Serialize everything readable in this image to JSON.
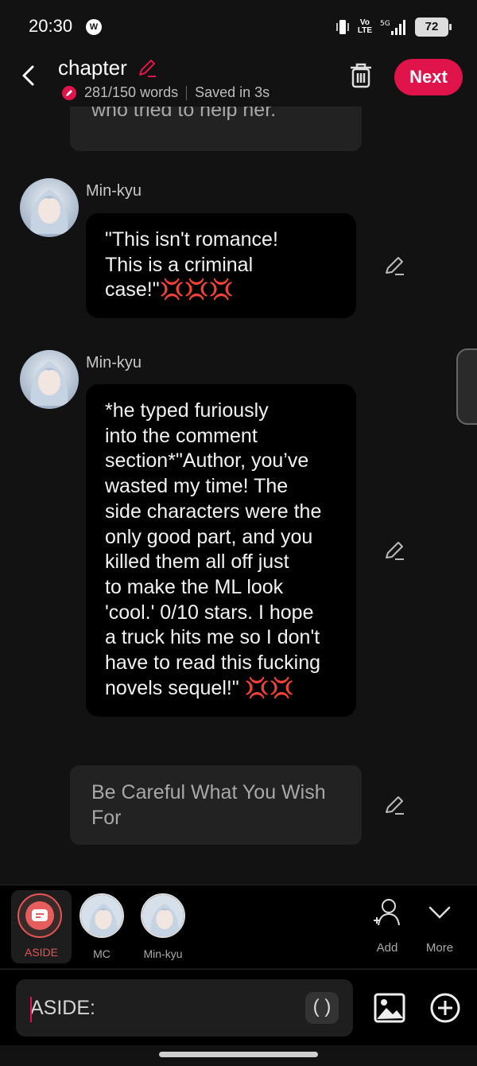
{
  "status_bar": {
    "time": "20:30",
    "network_label": "Vo\nLTE",
    "signal_label": "5G",
    "battery": "72"
  },
  "header": {
    "title": "chapter",
    "word_count": "281/150 words",
    "save_status": "Saved in 3s",
    "next_label": "Next"
  },
  "messages": [
    {
      "type": "aside",
      "text": "who tried to help her."
    },
    {
      "type": "character",
      "name": "Min-kyu",
      "lines": [
        "\"This isn't romance!",
        "This is a criminal",
        "case!\"💢💢💢"
      ]
    },
    {
      "type": "character",
      "name": "Min-kyu",
      "lines": [
        "*he typed furiously",
        "into the comment",
        "section*\"Author, you’ve",
        "wasted my time! The",
        "side characters were the",
        "only good part, and you",
        "killed them all off just",
        "to make the ML look",
        "'cool.' 0/10 stars. I hope",
        "a truck hits me so I don't",
        "have to read this fucking",
        "novels sequel!\" 💢💢"
      ]
    },
    {
      "type": "aside",
      "text": "Be Careful What You Wish For"
    }
  ],
  "character_bar": {
    "aside_label": "ASIDE",
    "characters": [
      {
        "name": "MC"
      },
      {
        "name": "Min-kyu"
      }
    ],
    "add_label": "Add",
    "more_label": "More"
  },
  "composer": {
    "prefix": "ASIDE:",
    "paren_label": "( )"
  },
  "colors": {
    "accent": "#e0144a",
    "background": "#121212",
    "bubble": "#000000",
    "aside_bg": "#222222"
  }
}
